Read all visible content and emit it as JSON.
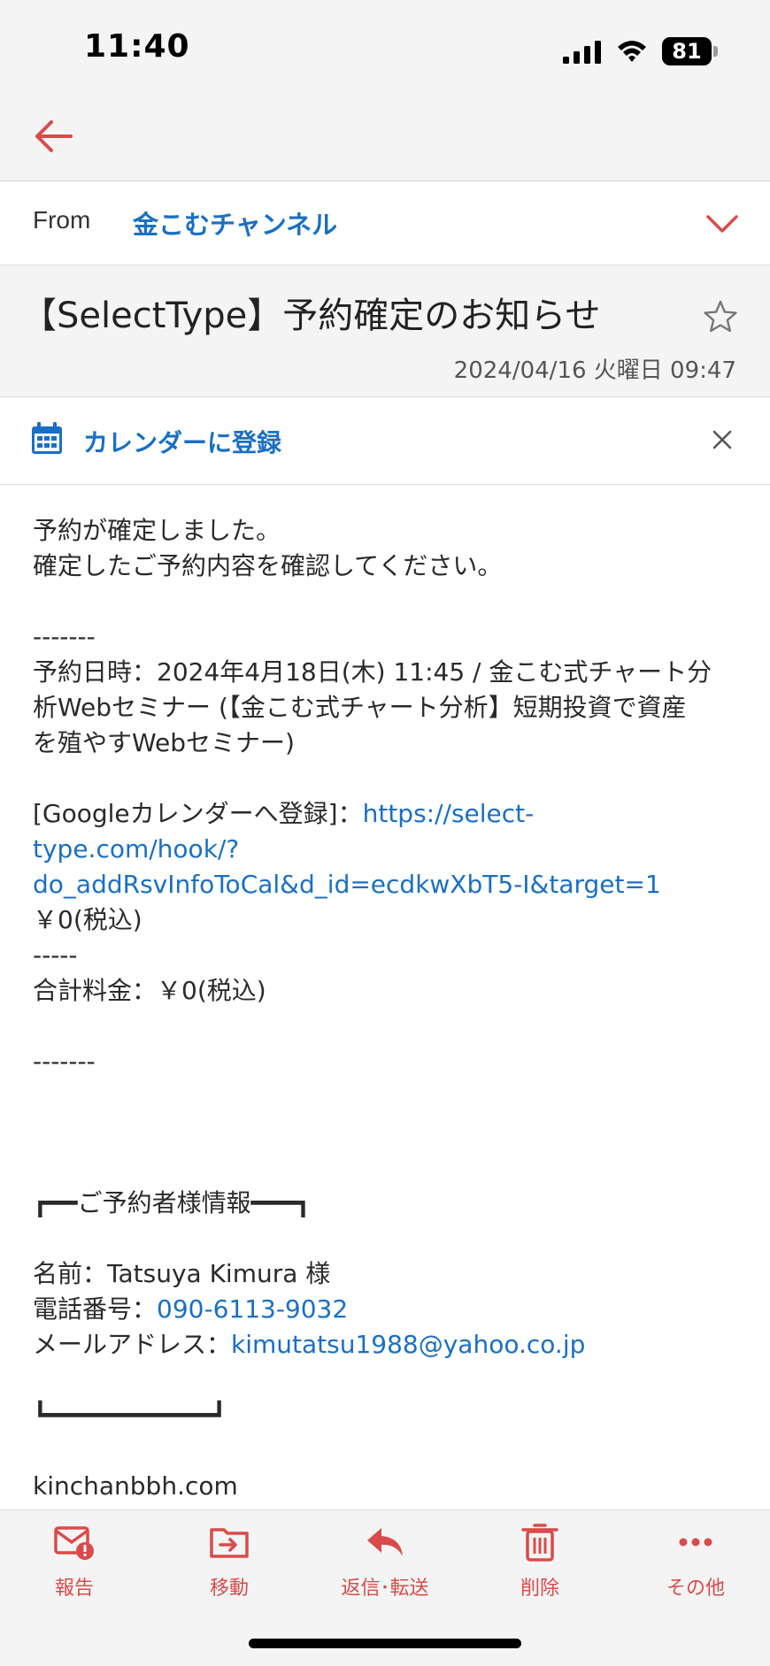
{
  "status_bar": {
    "time": "11:40",
    "battery": "81"
  },
  "header": {
    "from_label": "From",
    "sender": "金こむチャンネル"
  },
  "subject": {
    "title": "【SelectType】予約確定のお知らせ",
    "date": "2024/04/16 火曜日 09:47"
  },
  "calendar_banner": {
    "label": "カレンダーに登録"
  },
  "body": {
    "line1": "予約が確定しました。",
    "line2": "確定したご予約内容を確認してください。",
    "sep1": "-------",
    "booking_line1": "予約日時：2024年4月18日(木) 11:45 / 金こむ式チャート分",
    "booking_line2": "析Webセミナー (【金こむ式チャート分析】短期投資で資産",
    "booking_line3": "を殖やすWebセミナー)",
    "gcal_prefix": "[Googleカレンダーへ登録]：",
    "gcal_link1": "https://select-",
    "gcal_link2": "type.com/hook/?",
    "gcal_link3": "do_addRsvInfoToCal&d_id=ecdkwXbT5-I&target=1",
    "price": "￥0(税込)",
    "sep2": "-----",
    "total": "合計料金：￥0(税込)",
    "sep3": "-------",
    "box_top": "┏━━ご予約者様情報━━━┓",
    "name_line": "名前：Tatsuya Kimura 様",
    "phone_label": "電話番号：",
    "phone": "090-6113-9032",
    "email_label": "メールアドレス：",
    "email": "kimutatsu1988@yahoo.co.jp",
    "box_bottom": "┗━━━━━━━━━━━┛",
    "site": "kinchanbbh.com"
  },
  "toolbar": {
    "report": "報告",
    "move": "移動",
    "reply": "返信･転送",
    "delete": "削除",
    "more": "その他"
  },
  "colors": {
    "accent_red": "#d94b4b",
    "link_blue": "#1a6fc4",
    "bar_bg": "#f4f4f4"
  }
}
